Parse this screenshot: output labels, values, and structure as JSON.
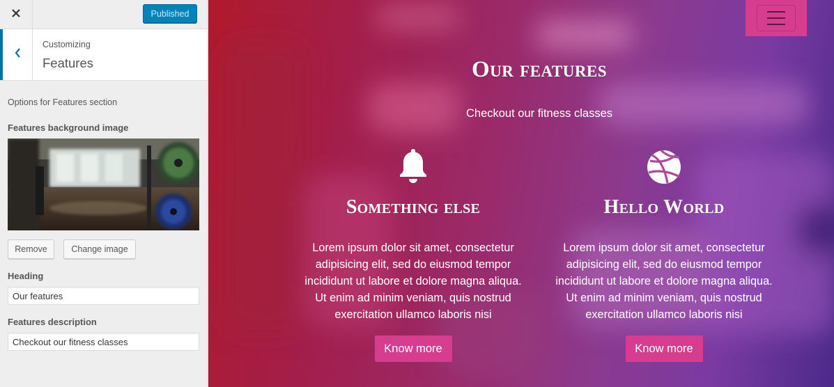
{
  "customizer": {
    "close_icon": "close-icon",
    "publish_label": "Published",
    "back_icon": "chevron-left-icon",
    "breadcrumb": "Customizing",
    "section_title": "Features",
    "section_description": "Options for Features section",
    "bg_image_label": "Features background image",
    "remove_label": "Remove",
    "change_image_label": "Change image",
    "heading_label": "Heading",
    "heading_value": "Our features",
    "description_label": "Features description",
    "description_value": "Checkout our fitness classes",
    "accent_color": "#0085ba"
  },
  "preview": {
    "menu_icon": "hamburger-menu-icon",
    "title": "Our features",
    "subtitle": "Checkout our fitness classes",
    "button_color": "#d63d8e",
    "features": [
      {
        "icon": "bell-icon",
        "title": "Something else",
        "text": "Lorem ipsum dolor sit amet, consectetur adipisicing elit, sed do eiusmod tempor incididunt ut labore et dolore magna aliqua. Ut enim ad minim veniam, quis nostrud exercitation ullamco laboris nisi",
        "button": "Know more"
      },
      {
        "icon": "basketball-icon",
        "title": "Hello World",
        "text": "Lorem ipsum dolor sit amet, consectetur adipisicing elit, sed do eiusmod tempor incididunt ut labore et dolore magna aliqua. Ut enim ad minim veniam, quis nostrud exercitation ullamco laboris nisi",
        "button": "Know more"
      }
    ]
  }
}
